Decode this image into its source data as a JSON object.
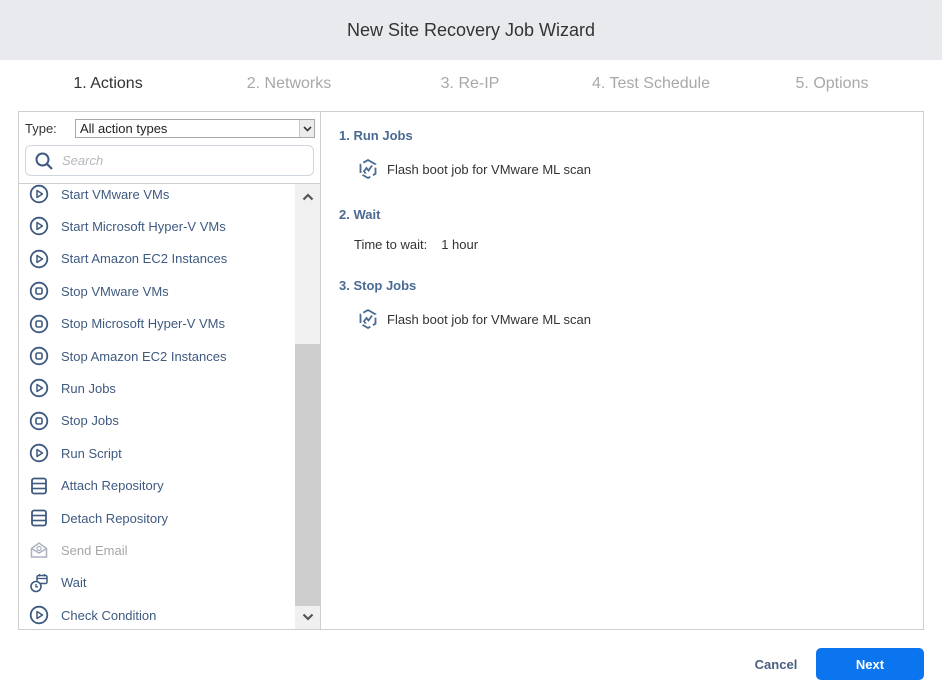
{
  "header": {
    "title": "New Site Recovery Job Wizard"
  },
  "steps": [
    {
      "label": "1. Actions",
      "active": true
    },
    {
      "label": "2. Networks",
      "active": false
    },
    {
      "label": "3. Re-IP",
      "active": false
    },
    {
      "label": "4. Test Schedule",
      "active": false
    },
    {
      "label": "5. Options",
      "active": false
    }
  ],
  "filter": {
    "type_label": "Type:",
    "type_value": "All action types",
    "search_placeholder": "Search"
  },
  "actions_list": [
    {
      "label": "Start VMware VMs",
      "icon": "play-circle-icon",
      "disabled": false
    },
    {
      "label": "Start Microsoft Hyper-V VMs",
      "icon": "play-circle-icon",
      "disabled": false
    },
    {
      "label": "Start Amazon EC2 Instances",
      "icon": "play-circle-icon",
      "disabled": false
    },
    {
      "label": "Stop VMware VMs",
      "icon": "stop-circle-icon",
      "disabled": false
    },
    {
      "label": "Stop Microsoft Hyper-V VMs",
      "icon": "stop-circle-icon",
      "disabled": false
    },
    {
      "label": "Stop Amazon EC2 Instances",
      "icon": "stop-circle-icon",
      "disabled": false
    },
    {
      "label": "Run Jobs",
      "icon": "play-circle-icon",
      "disabled": false
    },
    {
      "label": "Stop Jobs",
      "icon": "stop-circle-icon",
      "disabled": false
    },
    {
      "label": "Run Script",
      "icon": "play-circle-icon",
      "disabled": false
    },
    {
      "label": "Attach Repository",
      "icon": "repository-icon",
      "disabled": false
    },
    {
      "label": "Detach Repository",
      "icon": "repository-icon",
      "disabled": false
    },
    {
      "label": "Send Email",
      "icon": "email-icon",
      "disabled": true
    },
    {
      "label": "Wait",
      "icon": "wait-clock-icon",
      "disabled": false
    },
    {
      "label": "Check Condition",
      "icon": "play-circle-icon",
      "disabled": false
    }
  ],
  "sequence": {
    "sections": [
      {
        "title": "1. Run Jobs",
        "job": "Flash boot job for VMware ML scan"
      },
      {
        "title": "2. Wait",
        "wait_label": "Time to wait:",
        "wait_value": "1 hour"
      },
      {
        "title": "3. Stop Jobs",
        "job": "Flash boot job for VMware ML scan"
      }
    ]
  },
  "footer": {
    "cancel_label": "Cancel",
    "next_label": "Next"
  },
  "colors": {
    "accent": "#0a75ef",
    "link": "#3e5a80",
    "section_title": "#4a6a93"
  }
}
